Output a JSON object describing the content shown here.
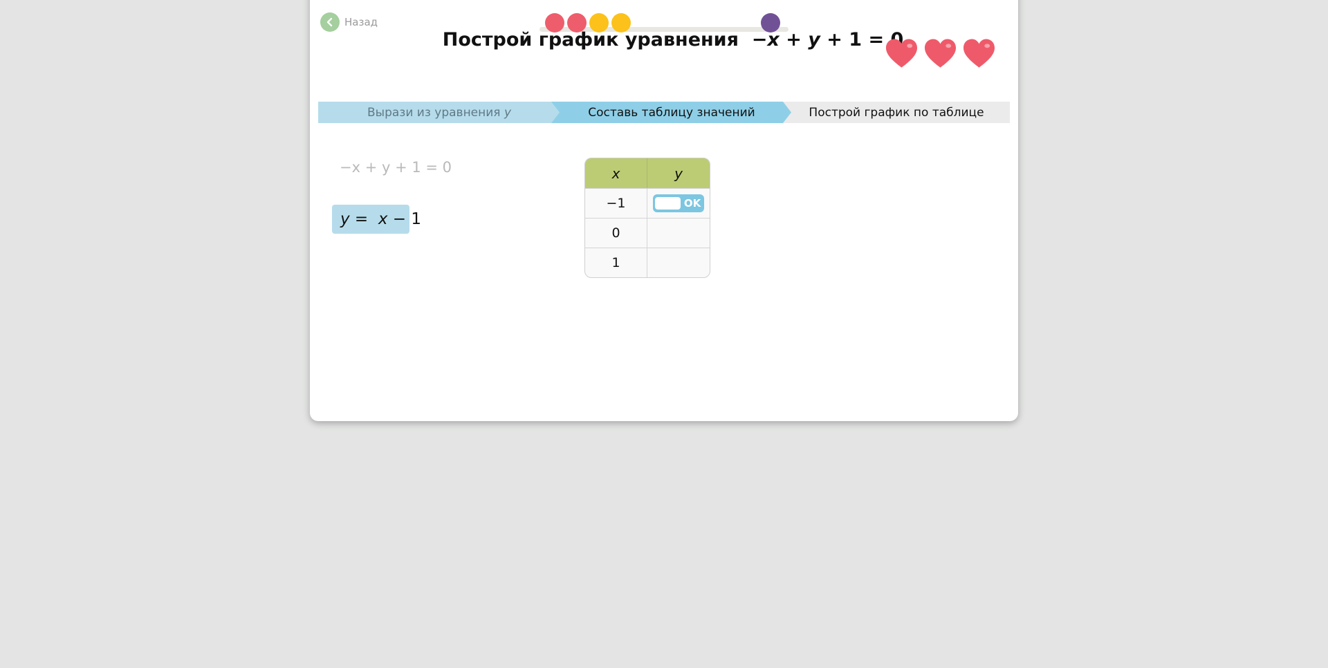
{
  "nav": {
    "back_label": "Назад"
  },
  "progress": {
    "dots": [
      {
        "color": "#ee5d6c"
      },
      {
        "color": "#ee5d6c"
      },
      {
        "color": "#fcc21b"
      },
      {
        "color": "#fcc21b"
      },
      {
        "color": "#715196"
      }
    ]
  },
  "header": {
    "title_text": "Построй график уравнения",
    "eq_minus": "−",
    "eq_x": "x",
    "eq_plus": " + ",
    "eq_y": "y",
    "eq_rest": " + 1 = 0"
  },
  "lives": {
    "count": 3,
    "color": "#ef5a6a"
  },
  "steps": [
    {
      "label": "Вырази из уравнения",
      "var": "y"
    },
    {
      "label": "Составь таблицу значений"
    },
    {
      "label": "Построй график по таблице"
    }
  ],
  "work": {
    "original_equation": "−x + y + 1 = 0",
    "solved_y": "y",
    "solved_eq": " =  ",
    "solved_x": "x",
    "solved_rest": " − 1"
  },
  "table": {
    "headers": [
      "x",
      "y"
    ],
    "rows": [
      {
        "x": "−1",
        "y": ""
      },
      {
        "x": "0",
        "y": ""
      },
      {
        "x": "1",
        "y": ""
      }
    ],
    "ok_label": "OK"
  }
}
